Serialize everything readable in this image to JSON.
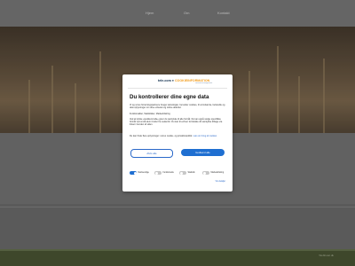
{
  "header": {
    "nav": [
      "Hjem",
      "Om",
      "Kontakt"
    ]
  },
  "footer": {
    "text": "Webhotel.dk"
  },
  "consent": {
    "brand_main": "tele-com",
    "brand_accent": "COOKIEINFORMATION",
    "brand_sub": "consent management",
    "title": "Du kontrollerer dine egne data",
    "para1": "Vi og vores forretningspartnere bruger teknologier, herunder cookies, til at indsamle, behandle og dele oplysninger om dine enheder og online aktivitet.",
    "para2": "Funktionalitet, Statistikker, Markedsføring",
    "para3": "Ved at trykke »Godkend alle« giver du samtykke til alle formål. Du kan også vælge specifikke formål ved at slå dem til eller fra nedenfor. Du kan til enhver tid trække dit samtykke tilbage via linket i bunden af siden.",
    "para4": "Du kan finde flere oplysninger i vores cookie- og privatlivspolitik.",
    "link_text": "Læs om brug af cookies",
    "reject_label": "Afvis alle",
    "accept_label": "Godkend alle",
    "toggles": [
      {
        "label": "Nødvendige",
        "on": true
      },
      {
        "label": "Funktionelle",
        "on": false
      },
      {
        "label": "Statistik",
        "on": false
      },
      {
        "label": "Markedsføring",
        "on": false
      }
    ],
    "details_label": "Vis detaljer"
  }
}
